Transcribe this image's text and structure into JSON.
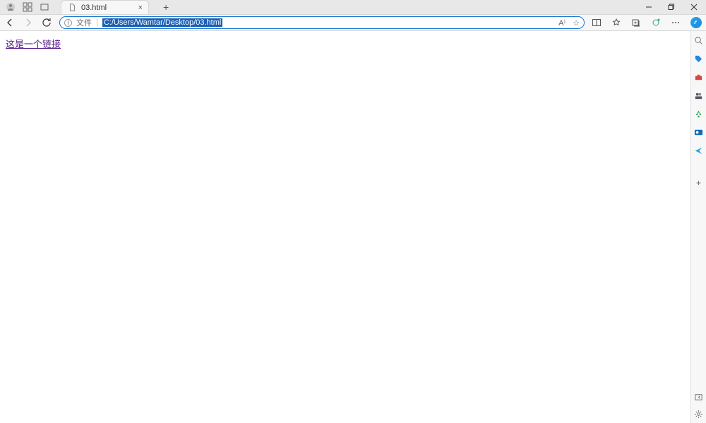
{
  "titlebar": {
    "tab_title": "03.html",
    "close_glyph": "×",
    "newtab_glyph": "+"
  },
  "toolbar": {
    "addr_prefix": "文件",
    "addr_sep": "|",
    "addr_url": "C:/Users/Wamtar/Desktop/03.html",
    "read_aloud": "A⁾",
    "star": "☆"
  },
  "content": {
    "link_text": "这是一个链接"
  },
  "sidebar": {
    "search_color": "#666",
    "tag_color": "#1e88e5",
    "brief_color": "#d64545",
    "people_color": "#556",
    "recycle_color": "#1e9e4a",
    "outlook_color": "#0f6cbd",
    "send_color": "#30a0d8",
    "plus": "+"
  }
}
